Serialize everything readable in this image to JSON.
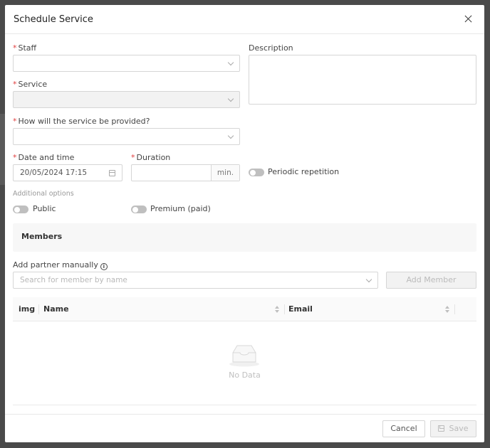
{
  "modal": {
    "title": "Schedule Service"
  },
  "form": {
    "staff": {
      "label": "Staff",
      "value": ""
    },
    "description": {
      "label": "Description",
      "value": ""
    },
    "service": {
      "label": "Service",
      "value": ""
    },
    "delivery": {
      "label": "How will the service be provided?",
      "value": ""
    },
    "datetime": {
      "label": "Date and time",
      "value": "20/05/2024 17:15"
    },
    "duration": {
      "label": "Duration",
      "value": "",
      "suffix": "min."
    },
    "periodic": {
      "label": "Periodic repetition",
      "on": false
    },
    "additional_options_label": "Additional options",
    "public": {
      "label": "Public",
      "on": false
    },
    "premium": {
      "label": "Premium (paid)",
      "on": false
    }
  },
  "members": {
    "title": "Members",
    "add_partner_label": "Add partner manually",
    "search_placeholder": "Search for member by name",
    "add_member_button": "Add Member",
    "table": {
      "columns": [
        "img",
        "Name",
        "Email"
      ],
      "rows": [],
      "empty_text": "No Data"
    }
  },
  "footer": {
    "cancel_label": "Cancel",
    "save_label": "Save"
  },
  "colors": {
    "required": "#e04040",
    "backdrop": "#4a4a4a"
  },
  "icons": [
    "close-icon",
    "chevron-down-icon",
    "calendar-icon",
    "info-icon",
    "sort-icon",
    "empty-inbox-icon",
    "save-icon"
  ]
}
